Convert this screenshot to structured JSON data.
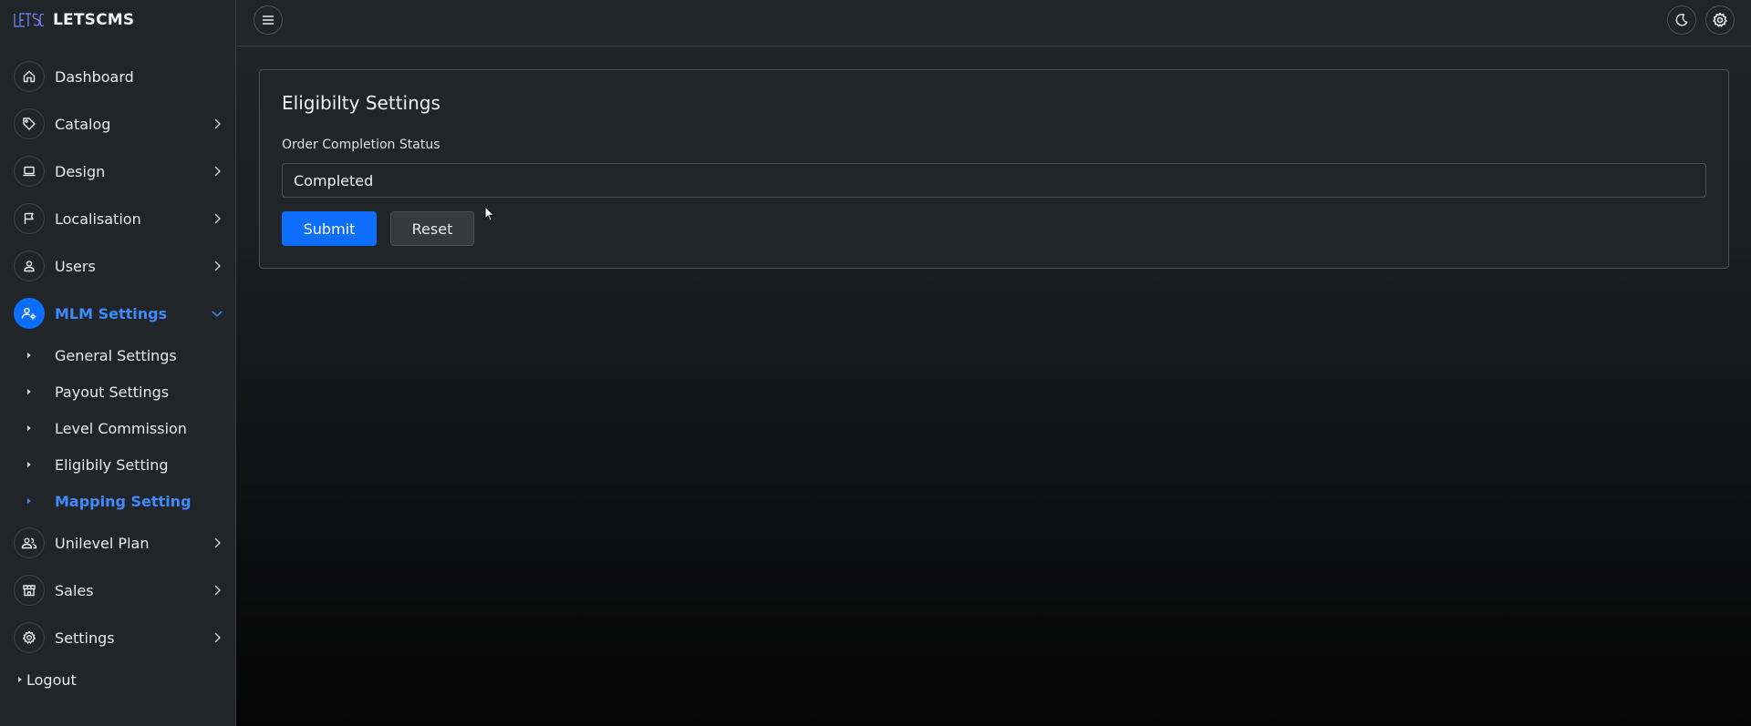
{
  "brand": {
    "logo": "LETSCMS logo",
    "name": "LETSCMS"
  },
  "sidebar": {
    "items": [
      {
        "label": "Dashboard",
        "icon": "home-icon",
        "has_chevron": false
      },
      {
        "label": "Catalog",
        "icon": "tag-icon",
        "has_chevron": true
      },
      {
        "label": "Design",
        "icon": "laptop-icon",
        "has_chevron": true
      },
      {
        "label": "Localisation",
        "icon": "flag-icon",
        "has_chevron": true
      },
      {
        "label": "Users",
        "icon": "user-icon",
        "has_chevron": true
      },
      {
        "label": "MLM Settings",
        "icon": "user-gear-icon",
        "has_chevron": true,
        "expanded": true,
        "active": true
      }
    ],
    "mlm_subitems": [
      {
        "label": "General Settings"
      },
      {
        "label": "Payout Settings"
      },
      {
        "label": "Level Commission"
      },
      {
        "label": "Eligibily Setting"
      },
      {
        "label": "Mapping Setting",
        "active": true
      }
    ],
    "items_after": [
      {
        "label": "Unilevel Plan",
        "icon": "users-icon",
        "has_chevron": true
      },
      {
        "label": "Sales",
        "icon": "store-icon",
        "has_chevron": true
      },
      {
        "label": "Settings",
        "icon": "gear-icon",
        "has_chevron": true
      }
    ],
    "logout_label": "Logout"
  },
  "topbar": {
    "menu_icon": "hamburger-icon",
    "theme_icon": "moon-icon",
    "settings_icon": "gear-icon"
  },
  "card": {
    "title": "Eligibilty Settings",
    "field_label": "Order Completion Status",
    "field_value": "Completed",
    "submit_label": "Submit",
    "reset_label": "Reset"
  },
  "colors": {
    "accent": "#0d6efd",
    "active_text": "#3d8bfd",
    "surface": "#212529",
    "border": "#495057"
  }
}
